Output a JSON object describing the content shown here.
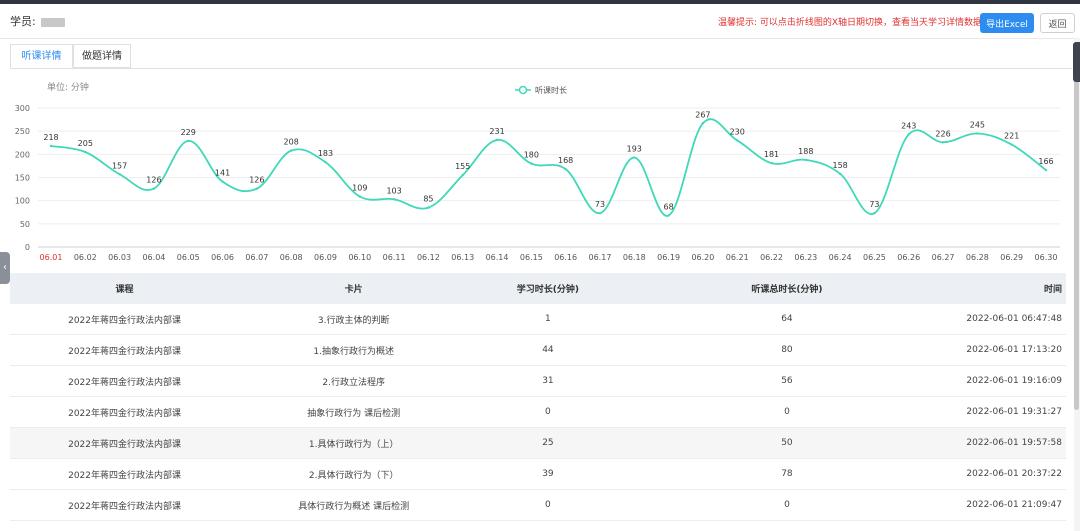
{
  "header": {
    "student_label": "学员:",
    "tip": "温馨提示: 可以点击折线图的X轴日期切换，查看当天学习详情数据",
    "export_label": "导出Excel",
    "back_label": "返回"
  },
  "tabs": [
    {
      "label": "听课详情",
      "active": true
    },
    {
      "label": "做题详情",
      "active": false
    }
  ],
  "chart_unit": "单位: 分钟",
  "chart_data": {
    "type": "line",
    "legend": "听课时长",
    "legend_position": "top-center",
    "x": [
      "06.01",
      "06.02",
      "06.03",
      "06.04",
      "06.05",
      "06.06",
      "06.07",
      "06.08",
      "06.09",
      "06.10",
      "06.11",
      "06.12",
      "06.13",
      "06.14",
      "06.15",
      "06.16",
      "06.17",
      "06.18",
      "06.19",
      "06.20",
      "06.21",
      "06.22",
      "06.23",
      "06.24",
      "06.25",
      "06.26",
      "06.27",
      "06.28",
      "06.29",
      "06.30"
    ],
    "values": [
      218,
      205,
      157,
      126,
      229,
      141,
      126,
      208,
      183,
      109,
      103,
      85,
      155,
      231,
      180,
      168,
      73,
      193,
      68,
      267,
      230,
      181,
      188,
      158,
      73,
      243,
      226,
      245,
      221,
      166
    ],
    "ylim": [
      0,
      300
    ],
    "yticks": [
      0,
      50,
      100,
      150,
      200,
      250,
      300
    ],
    "selected_x": "06.01",
    "grid": true,
    "colors": {
      "line": "#3fd8b8",
      "selected_tick": "#e13131"
    }
  },
  "table": {
    "columns": [
      "课程",
      "卡片",
      "学习时长(分钟)",
      "听课总时长(分钟)",
      "时间"
    ],
    "rows": [
      [
        "2022年蒋四金行政法内部课",
        "3.行政主体的判断",
        "1",
        "64",
        "2022-06-01 06:47:48"
      ],
      [
        "2022年蒋四金行政法内部课",
        "1.抽象行政行为概述",
        "44",
        "80",
        "2022-06-01 17:13:20"
      ],
      [
        "2022年蒋四金行政法内部课",
        "2.行政立法程序",
        "31",
        "56",
        "2022-06-01 19:16:09"
      ],
      [
        "2022年蒋四金行政法内部课",
        "抽象行政行为 课后检测",
        "0",
        "0",
        "2022-06-01 19:31:27"
      ],
      [
        "2022年蒋四金行政法内部课",
        "1.具体行政行为（上）",
        "25",
        "50",
        "2022-06-01 19:57:58"
      ],
      [
        "2022年蒋四金行政法内部课",
        "2.具体行政行为（下）",
        "39",
        "78",
        "2022-06-01 20:37:22"
      ],
      [
        "2022年蒋四金行政法内部课",
        "具体行政行为概述 课后检测",
        "0",
        "0",
        "2022-06-01 21:09:47"
      ]
    ]
  }
}
